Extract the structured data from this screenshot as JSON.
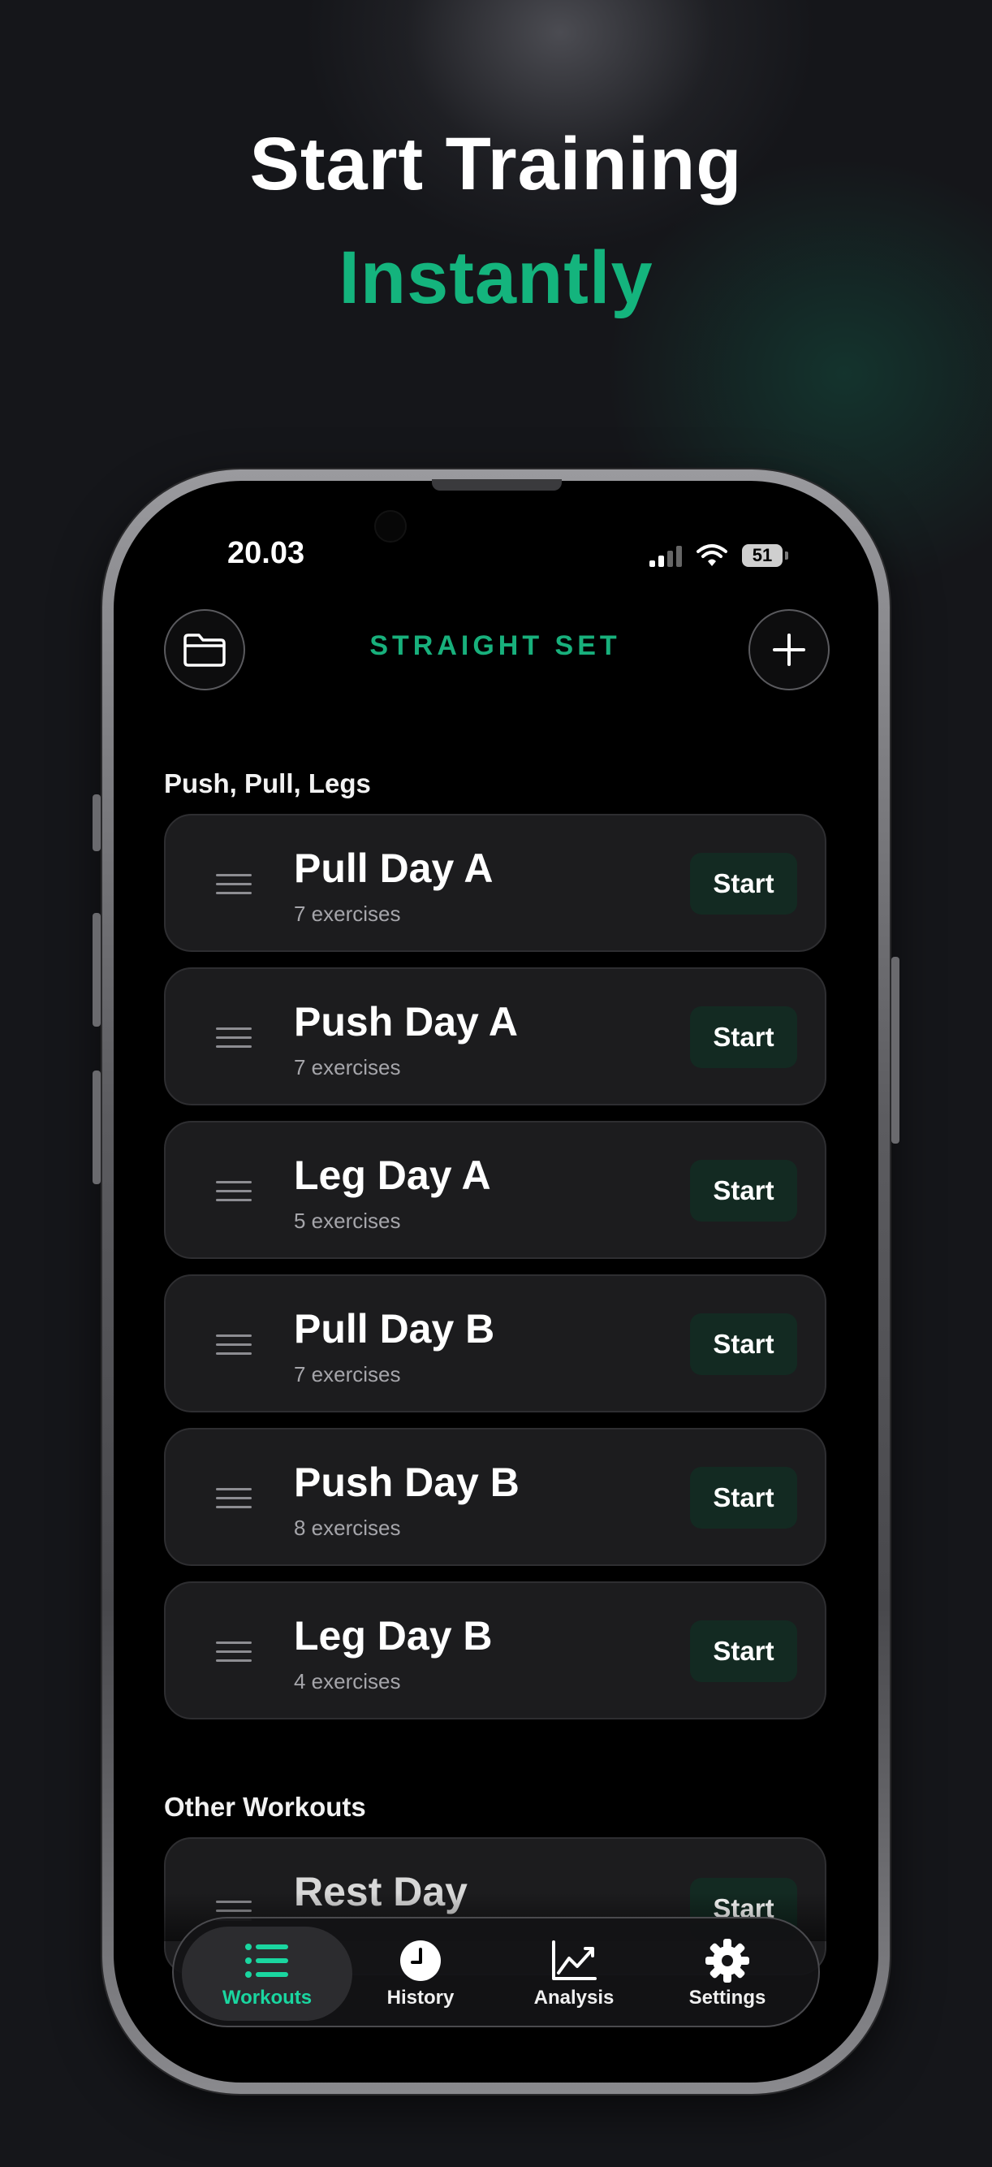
{
  "headline": {
    "line1": "Start Training",
    "line2": "Instantly"
  },
  "status_bar": {
    "time": "20.03",
    "battery": "51"
  },
  "header": {
    "title": "STRAIGHT SET",
    "left_icon": "folder-icon",
    "right_icon": "plus-icon"
  },
  "sections": [
    {
      "title": "Push, Pull, Legs",
      "workouts": [
        {
          "name": "Pull Day A",
          "count": "7 exercises",
          "action": "Start"
        },
        {
          "name": "Push Day A",
          "count": "7 exercises",
          "action": "Start"
        },
        {
          "name": "Leg Day A",
          "count": "5 exercises",
          "action": "Start"
        },
        {
          "name": "Pull Day B",
          "count": "7 exercises",
          "action": "Start"
        },
        {
          "name": "Push Day B",
          "count": "8 exercises",
          "action": "Start"
        },
        {
          "name": "Leg Day B",
          "count": "4 exercises",
          "action": "Start"
        }
      ]
    },
    {
      "title": "Other Workouts",
      "workouts": [
        {
          "name": "Rest Day",
          "action": "Start"
        }
      ]
    }
  ],
  "tabs": [
    {
      "label": "Workouts",
      "icon": "list-icon",
      "active": true
    },
    {
      "label": "History",
      "icon": "clock-icon",
      "active": false
    },
    {
      "label": "Analysis",
      "icon": "chart-icon",
      "active": false
    },
    {
      "label": "Settings",
      "icon": "gear-icon",
      "active": false
    }
  ],
  "colors": {
    "accent": "#14b47d",
    "tab_active": "#1ad6a0",
    "background": "#15161a",
    "card": "#1c1c1e"
  }
}
